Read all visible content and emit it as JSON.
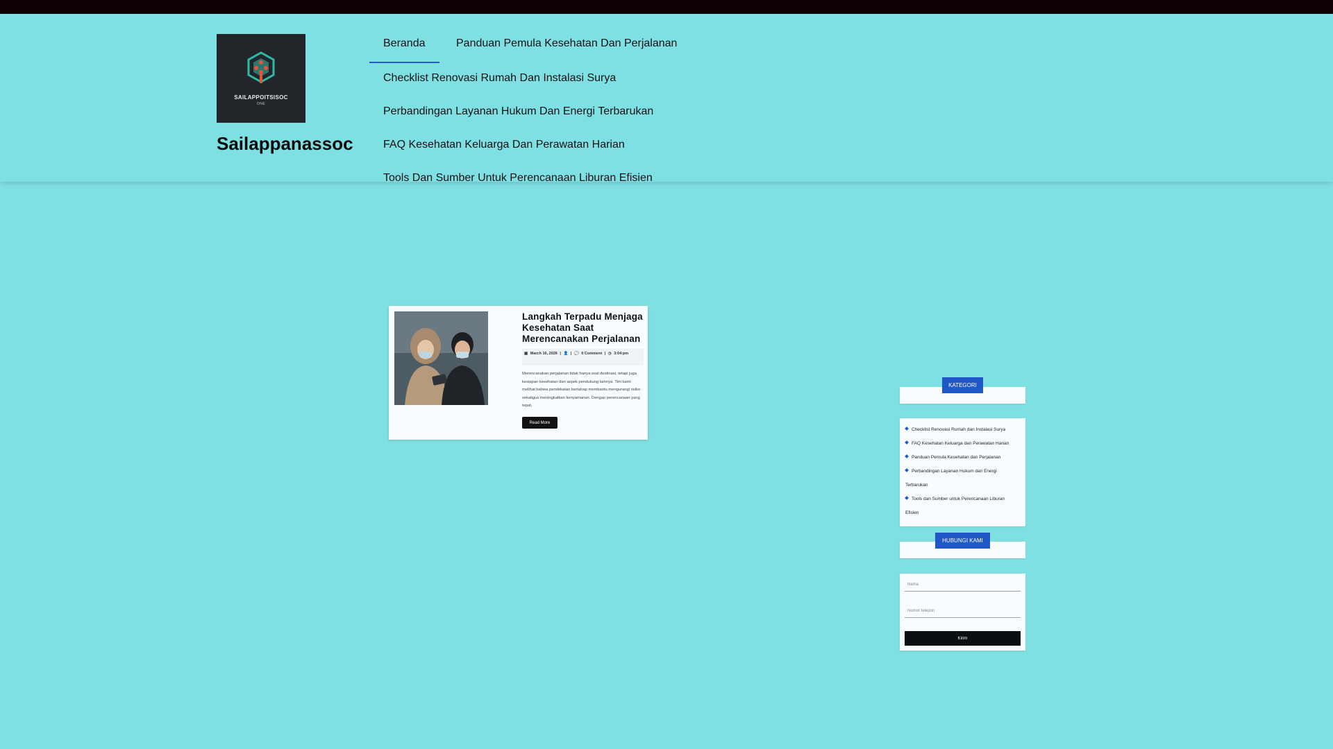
{
  "site": {
    "logo_text": "SAILAPPOITSISOC",
    "logo_sub": "ONE",
    "title": "Sailappanassoc"
  },
  "nav": {
    "items": [
      {
        "label": "Beranda",
        "active": true
      },
      {
        "label": "Panduan Pemula Kesehatan Dan Perjalanan"
      },
      {
        "label": "Checklist Renovasi Rumah Dan Instalasi Surya"
      },
      {
        "label": "Perbandingan Layanan Hukum Dan Energi Terbarukan"
      },
      {
        "label": "FAQ Kesehatan Keluarga Dan Perawatan Harian"
      },
      {
        "label": "Tools Dan Sumber Untuk Perencanaan Liburan Efisien"
      }
    ]
  },
  "post": {
    "title": "Langkah Terpadu Menjaga Kesehatan Saat Merencanakan Perjalanan",
    "date": "March 16, 2026",
    "comments": "0 Comment",
    "time": "3:04 pm",
    "excerpt": "Merencanakan perjalanan tidak hanya soal destinasi, tetapi juga kesiapan kesehatan dan aspek pendukung lainnya. Tim kami melihat bahwa pendekatan bertahap membantu mengurangi risiko sekaligus meningkatkan kenyamanan. Dengan perencanaan yang tepat,",
    "read_more": "Read More"
  },
  "sidebar": {
    "category_title": "KATEGORI",
    "categories": [
      "Checklist Renovasi Rumah dan Instalasi Surya",
      "FAQ Kesehatan Keluarga dan Perawatan Harian",
      "Panduan Pemula Kesehatan dan Perjalanan",
      "Perbandingan Layanan Hukum dan Energi Terbarukan",
      "Tools dan Sumber untuk Perencanaan Liburan Efisien"
    ],
    "contact_title": "HUBUNGI KAMI",
    "contact": {
      "name_placeholder": "Nama",
      "phone_placeholder": "Nomor telepon",
      "submit_label": "Kirim"
    }
  },
  "colors": {
    "background": "#7fe0e4",
    "topbar": "#0d0103",
    "accent": "#1f56c8"
  }
}
